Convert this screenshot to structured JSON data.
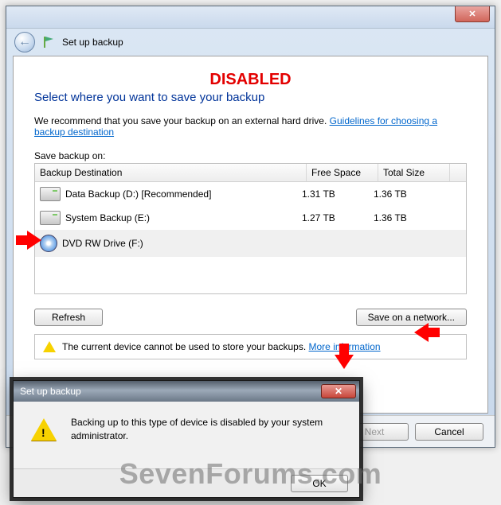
{
  "annotation": {
    "stamp": "DISABLED",
    "watermark": "SevenForums.com"
  },
  "window": {
    "nav_title": "Set up backup",
    "heading": "Select where you want to save your backup",
    "recommend_prefix": "We recommend that you save your backup on an external hard drive. ",
    "recommend_link": "Guidelines for choosing a backup destination",
    "save_label": "Save backup on:",
    "columns": {
      "dest": "Backup Destination",
      "free": "Free Space",
      "size": "Total Size"
    },
    "drives": [
      {
        "name": "Data Backup (D:) [Recommended]",
        "free": "1.31 TB",
        "size": "1.36 TB",
        "type": "hdd",
        "selected": false
      },
      {
        "name": "System Backup (E:)",
        "free": "1.27 TB",
        "size": "1.36 TB",
        "type": "hdd",
        "selected": false
      },
      {
        "name": "DVD RW Drive (F:)",
        "free": "",
        "size": "",
        "type": "dvd",
        "selected": true
      }
    ],
    "buttons": {
      "refresh": "Refresh",
      "network": "Save on a network...",
      "next": "Next",
      "cancel": "Cancel"
    },
    "warning_text": "The current device cannot be used to store your backups. ",
    "warning_link": "More information"
  },
  "dialog": {
    "title": "Set up backup",
    "message": "Backing up to this type of device is disabled by your system administrator.",
    "ok": "OK"
  }
}
